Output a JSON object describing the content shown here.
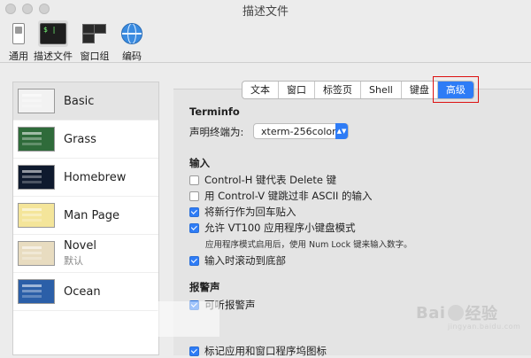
{
  "window": {
    "title": "描述文件"
  },
  "toolbar": {
    "items": [
      {
        "label": "通用",
        "icon": "switch-icon"
      },
      {
        "label": "描述文件",
        "icon": "terminal-icon"
      },
      {
        "label": "窗口组",
        "icon": "window-group-icon"
      },
      {
        "label": "编码",
        "icon": "globe-icon"
      }
    ]
  },
  "sidebar": {
    "profiles": [
      {
        "name": "Basic",
        "sub": "",
        "thumb_color": "#f2f2f2"
      },
      {
        "name": "Grass",
        "sub": "",
        "thumb_color": "#2f6b3a"
      },
      {
        "name": "Homebrew",
        "sub": "",
        "thumb_color": "#0f1a2e"
      },
      {
        "name": "Man Page",
        "sub": "",
        "thumb_color": "#f4e59a"
      },
      {
        "name": "Novel",
        "sub": "默认",
        "thumb_color": "#e8dcc0"
      },
      {
        "name": "Ocean",
        "sub": "",
        "thumb_color": "#2b5fa8"
      }
    ]
  },
  "tabs": [
    "文本",
    "窗口",
    "标签页",
    "Shell",
    "键盘",
    "高级"
  ],
  "active_tab": "高级",
  "terminfo": {
    "title": "Terminfo",
    "label": "声明终端为:",
    "select_value": "xterm-256color"
  },
  "input": {
    "title": "输入",
    "options": [
      {
        "label": "Control-H 键代表 Delete 键",
        "checked": false
      },
      {
        "label": "用 Control-V 键跳过非 ASCII 的输入",
        "checked": false
      },
      {
        "label": "将新行作为回车贴入",
        "checked": true
      },
      {
        "label": "允许 VT100 应用程序小键盘模式",
        "checked": true
      }
    ],
    "note": "应用程序模式启用后，使用 Num Lock 键来输入数字。",
    "scroll_option": {
      "label": "输入时滚动到底部",
      "checked": true
    }
  },
  "alert": {
    "title": "报警声",
    "options": [
      {
        "label": "可听报警声",
        "checked": true
      },
      {
        "label": "标记应用和窗口程序坞图标",
        "checked": true
      }
    ]
  },
  "watermark": {
    "text_a": "Bai",
    "text_b": "经验",
    "sub": "jingyan.baidu.com"
  },
  "colors": {
    "accent": "#2e7cf6",
    "highlight_box": "#dd1111"
  }
}
